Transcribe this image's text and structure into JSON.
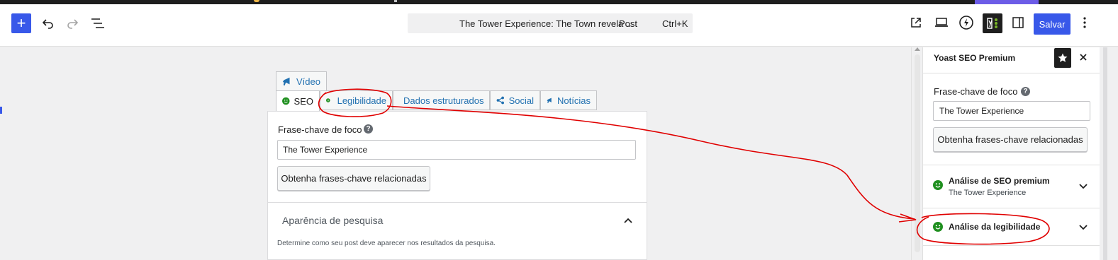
{
  "toolbar": {
    "add_label": "+",
    "save_label": "Salvar",
    "command": {
      "title": "The Tower Experience: The Town revela ...",
      "post_type": "· Post",
      "shortcut": "Ctrl+K"
    }
  },
  "tabs": {
    "video": "Vídeo",
    "seo": "SEO",
    "legibilidade": "Legibilidade",
    "dados": "Dados estruturados",
    "social": "Social",
    "noticias": "Notícias"
  },
  "seo_panel": {
    "focus_label": "Frase-chave de foco",
    "focus_value": "The Tower Experience",
    "related_button": "Obtenha frases-chave relacionadas",
    "appearance_title": "Aparência de pesquisa",
    "appearance_desc": "Determine como seu post deve aparecer nos resultados da pesquisa."
  },
  "sidebar": {
    "title": "Yoast SEO Premium",
    "focus_label": "Frase-chave de foco",
    "focus_value": "The Tower Experience",
    "related_button": "Obtenha frases-chave relacionadas",
    "seo_analysis": {
      "title": "Análise de SEO premium",
      "subtitle": "The Tower Experience"
    },
    "readability": {
      "title": "Análise da legibilidade"
    }
  },
  "colors": {
    "primary": "#3858e9",
    "link": "#2271b1",
    "good": "#1f8f1f",
    "annotation": "#e00000"
  }
}
